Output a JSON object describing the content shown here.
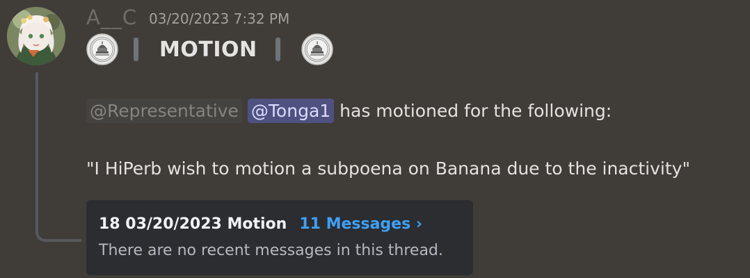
{
  "message": {
    "username": "A__C",
    "timestamp": "03/20/2023 7:32 PM",
    "title": "MOTION",
    "mention_role": "@Representative",
    "mention_user": "@Tonga1",
    "body_line1_rest": "has motioned for the following:",
    "body_line2": "\"I HiPerb wish to motion a subpoena on Banana due to the inactivity\""
  },
  "thread": {
    "name": "18 03/20/2023 Motion",
    "messages_link": "11 Messages ›",
    "preview": "There are no recent messages in this thread."
  },
  "icons": {
    "avatar": "avatar-image",
    "seal": "capitol-seal-icon"
  },
  "colors": {
    "background": "#403d38",
    "thread_card": "#2b2d31",
    "user_mention_bg": "#4f5280",
    "link": "#3ea1f5"
  }
}
